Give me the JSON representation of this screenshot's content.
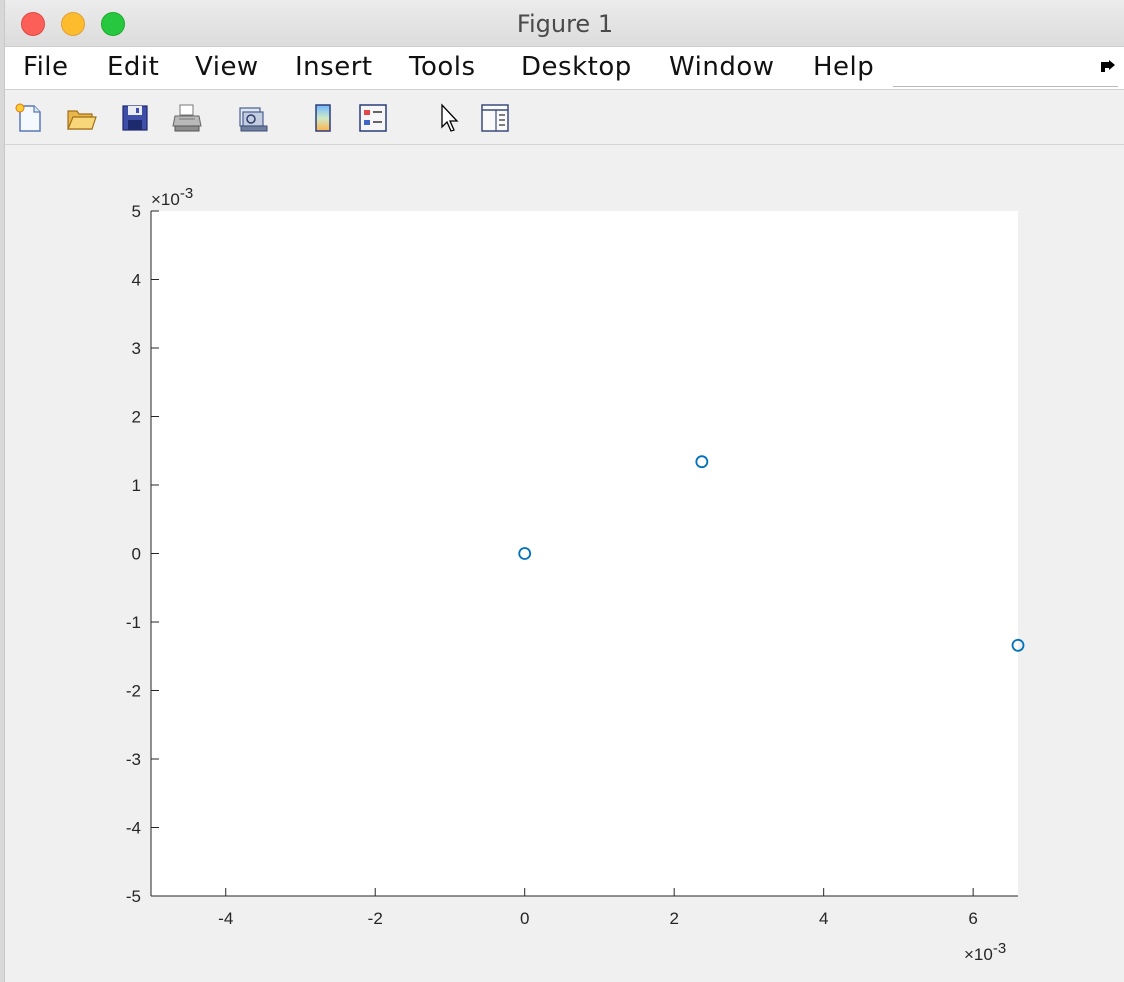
{
  "window": {
    "title": "Figure 1"
  },
  "menu": {
    "items": [
      "File",
      "Edit",
      "View",
      "Insert",
      "Tools",
      "Desktop",
      "Window",
      "Help"
    ]
  },
  "toolbar": {
    "icons": [
      "new-figure-icon",
      "open-file-icon",
      "save-icon",
      "print-icon",
      "print-preview-icon",
      "colorbar-icon",
      "legend-icon",
      "pointer-icon",
      "property-editor-icon"
    ]
  },
  "chart_data": {
    "type": "scatter",
    "marker": "circle",
    "color": "#0072bd",
    "x": [
      0.0,
      0.00237,
      0.0066
    ],
    "y": [
      0.0,
      0.00134,
      -0.00134
    ],
    "xlim": [
      -0.005,
      0.0066
    ],
    "ylim": [
      -0.005,
      0.005
    ],
    "x_ticks": [
      -0.004,
      -0.002,
      0,
      0.002,
      0.004,
      0.006
    ],
    "x_tick_labels": [
      "-4",
      "-2",
      "0",
      "2",
      "4",
      "6"
    ],
    "y_ticks": [
      -0.005,
      -0.004,
      -0.003,
      -0.002,
      -0.001,
      0,
      0.001,
      0.002,
      0.003,
      0.004,
      0.005
    ],
    "y_tick_labels": [
      "-5",
      "-4",
      "-3",
      "-2",
      "-1",
      "0",
      "1",
      "2",
      "3",
      "4",
      "5"
    ],
    "x_exponent_label": "×10",
    "x_exponent": "-3",
    "y_exponent_label": "×10",
    "y_exponent": "-3",
    "grid": false
  }
}
